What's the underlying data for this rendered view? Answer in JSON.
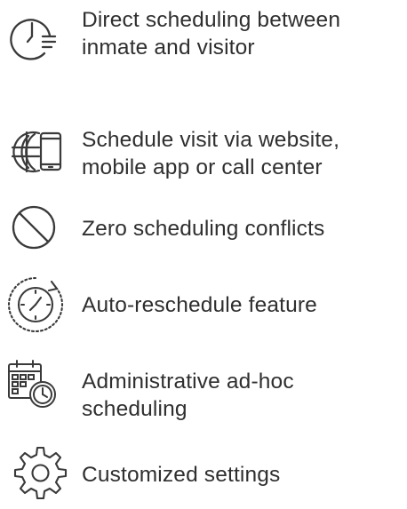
{
  "features": [
    {
      "icon": "clock-list-icon",
      "lines": [
        "Direct scheduling between",
        "inmate and visitor"
      ]
    },
    {
      "icon": "globe-mobile-icon",
      "lines": [
        "Schedule visit via website,",
        "mobile app or call center"
      ]
    },
    {
      "icon": "no-conflict-icon",
      "lines": [
        "Zero scheduling conflicts"
      ]
    },
    {
      "icon": "auto-reschedule-clock-icon",
      "lines": [
        "Auto-reschedule feature"
      ]
    },
    {
      "icon": "calendar-clock-icon",
      "lines": [
        "Administrative ad-hoc",
        "scheduling"
      ]
    },
    {
      "icon": "settings-gear-icon",
      "lines": [
        "Customized settings"
      ]
    }
  ],
  "colors": {
    "text": "#2f2f2f",
    "icon": "#3a3a3a",
    "background": "#ffffff"
  }
}
